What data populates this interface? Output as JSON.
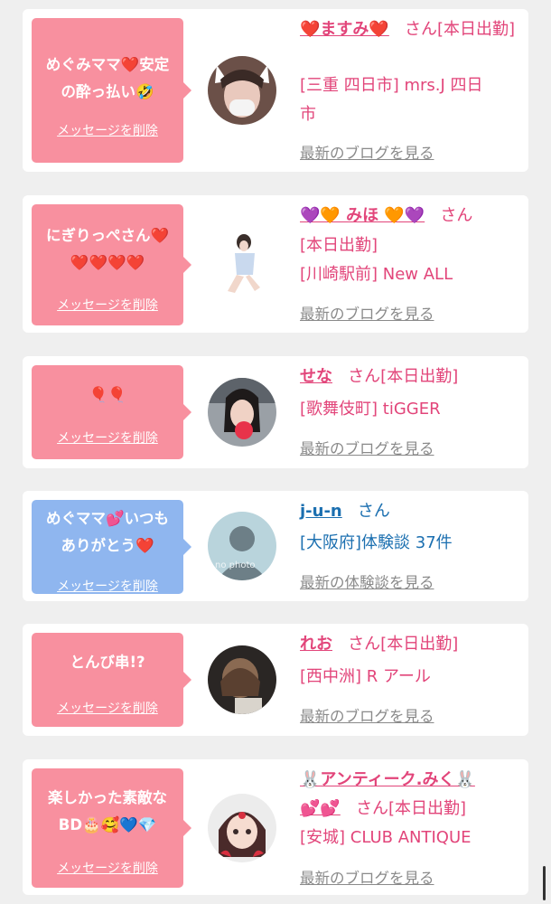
{
  "cards": [
    {
      "message": "めぐみママ❤️安定\nの酔っ払い🤣",
      "delete_label": "メッセージを削除",
      "name": "❤️ますみ❤️",
      "san": "さん[本日出勤]",
      "info": "[三重 四日市] mrs.J 四日\n市",
      "link": "最新のブログを見る",
      "theme": "pink"
    },
    {
      "message": "にぎりっぺさん❤️\n❤️❤️❤️❤️",
      "delete_label": "メッセージを削除",
      "name": "💜🧡 みほ 🧡💜",
      "san": "さん",
      "info": "[本日出勤]\n[川崎駅前] New ALL",
      "link": "最新のブログを見る",
      "theme": "pink"
    },
    {
      "message": "🎈🎈",
      "delete_label": "メッセージを削除",
      "name": "せな",
      "san": "さん[本日出勤]",
      "info": "[歌舞伎町] tiGGER",
      "link": "最新のブログを見る",
      "theme": "pink"
    },
    {
      "message": "めぐママ💕いつも\nありがとう❤️",
      "delete_label": "メッセージを削除",
      "name": "j-u-n",
      "san": "さん",
      "info": "[大阪府]体験談 37件",
      "link": "最新の体験談を見る",
      "avatar_text": "no photo",
      "theme": "blue"
    },
    {
      "message": "とんび串!?",
      "delete_label": "メッセージを削除",
      "name": "れお",
      "san": "さん[本日出勤]",
      "info": "[西中洲] R アール",
      "link": "最新のブログを見る",
      "theme": "pink"
    },
    {
      "message": "楽しかった素敵な\nBD🎂🥰💙💎",
      "delete_label": "メッセージを削除",
      "name": "🐰アンティーク.みく🐰\n💕💕",
      "san": "さん[本日出勤]",
      "info": "[安城] CLUB ANTIQUE",
      "link": "最新のブログを見る",
      "theme": "pink"
    }
  ],
  "colors": {
    "pink_bubble": "#f8909f",
    "blue_bubble": "#8fb6ef",
    "cast_text": "#e2457a",
    "user_text": "#1b6fb0",
    "link_gray": "#8a8a8a",
    "page_bg": "#efefef"
  }
}
